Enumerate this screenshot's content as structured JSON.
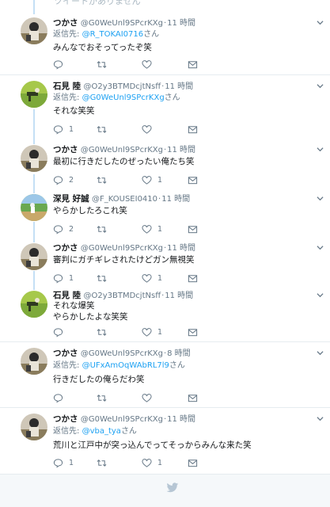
{
  "top_notice": "ツイートがありません",
  "colors": {
    "link": "#1da1f2",
    "meta": "#657786",
    "thread": "#c4dff5",
    "icon": "#657786"
  },
  "tweets": [
    {
      "name": "つかさ",
      "handle": "@G0WeUnl9SPcrKXg",
      "time": "11 時間",
      "reply_prefix": "返信先: ",
      "reply_to": "@R_TOKAI0716",
      "reply_suffix": "さん",
      "lines": [
        "みんなでおそってったぞ笑"
      ],
      "counts": {
        "reply": "",
        "retweet": "",
        "like": ""
      },
      "avatar": "avatar-a"
    },
    {
      "name": "石見 陸",
      "handle": "@O2y3BTMDcjtNsff",
      "time": "11 時間",
      "reply_prefix": "返信先: ",
      "reply_to": "@G0WeUnl9SPcrKXg",
      "reply_suffix": "さん",
      "lines": [
        "それな笑笑"
      ],
      "counts": {
        "reply": "1",
        "retweet": "",
        "like": ""
      },
      "avatar": "avatar-b"
    },
    {
      "name": "つかさ",
      "handle": "@G0WeUnl9SPcrKXg",
      "time": "11 時間",
      "lines": [
        "最初に行きだしたのぜったい俺たち笑"
      ],
      "counts": {
        "reply": "2",
        "retweet": "",
        "like": "1"
      },
      "avatar": "avatar-a"
    },
    {
      "name": "深見 好誠",
      "handle": "@F_KOUSEI0410",
      "time": "11 時間",
      "lines": [
        "やらかしたろこれ笑"
      ],
      "counts": {
        "reply": "2",
        "retweet": "",
        "like": "1"
      },
      "avatar": "avatar-c"
    },
    {
      "name": "つかさ",
      "handle": "@G0WeUnl9SPcrKXg",
      "time": "11 時間",
      "lines": [
        "審判にガチギレされたけどガン無視笑"
      ],
      "counts": {
        "reply": "1",
        "retweet": "",
        "like": "1"
      },
      "avatar": "avatar-a"
    },
    {
      "name": "石見 陸",
      "handle": "@O2y3BTMDcjtNsff",
      "time": "11 時間",
      "lines": [
        "それな爆笑",
        "やらかしたよな笑笑"
      ],
      "counts": {
        "reply": "",
        "retweet": "",
        "like": "1"
      },
      "avatar": "avatar-b"
    },
    {
      "name": "つかさ",
      "handle": "@G0WeUnl9SPcrKXg",
      "time": "8 時間",
      "reply_prefix": "返信先: ",
      "reply_to": "@UFxAmOqWAbRL7l9",
      "reply_suffix": "さん",
      "lines": [
        "行きだしたの俺らだわ笑"
      ],
      "counts": {
        "reply": "",
        "retweet": "",
        "like": ""
      },
      "avatar": "avatar-a"
    },
    {
      "name": "つかさ",
      "handle": "@G0WeUnl9SPcrKXg",
      "time": "11 時間",
      "reply_prefix": "返信先: ",
      "reply_to": "@vba_tya",
      "reply_suffix": "さん",
      "lines": [
        "荒川と江戸中が突っ込んでってそっからみんな来た笑"
      ],
      "counts": {
        "reply": "1",
        "retweet": "",
        "like": "1"
      },
      "avatar": "avatar-a"
    }
  ],
  "footer_icon": "twitter-bird-icon"
}
